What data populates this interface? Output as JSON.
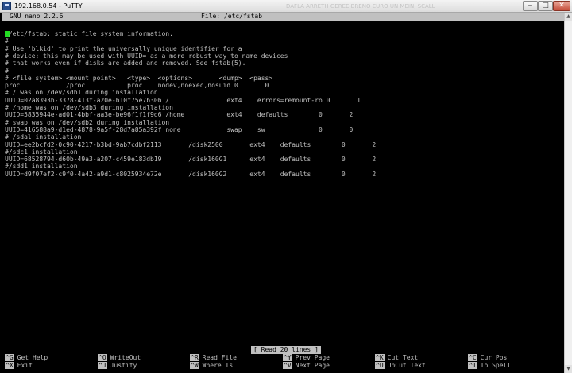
{
  "window": {
    "title": "192.168.0.54 - PuTTY",
    "ghost_text": "DAFLA ARRETH GEREE BRENO EURO UN MEIN, SCALL",
    "minimize_glyph": "‒",
    "maximize_glyph": "□",
    "close_glyph": "✕"
  },
  "scrollbar": {
    "up_glyph": "▲",
    "down_glyph": "▼"
  },
  "nano": {
    "version": "GNU nano 2.2.6",
    "file_label": "File: /etc/fstab",
    "lines": [
      " /etc/fstab: static file system information.",
      "#",
      "# Use 'blkid' to print the universally unique identifier for a",
      "# device; this may be used with UUID= as a more robust way to name devices",
      "# that works even if disks are added and removed. See fstab(5).",
      "#",
      "# <file system> <mount point>   <type>  <options>       <dump>  <pass>",
      "proc            /proc           proc    nodev,noexec,nosuid 0       0",
      "# / was on /dev/sdb1 during installation",
      "UUID=02a8393b-3378-413f-a20e-b10f75e7b30b /               ext4    errors=remount-ro 0       1",
      "# /home was on /dev/sdb3 during installation",
      "UUID=5835944e-ad01-4bbf-aa3e-be96f1f1f9d6 /home           ext4    defaults        0       2",
      "# swap was on /dev/sdb2 during installation",
      "UUID=416588a9-d1ed-4878-9a5f-28d7a85a392f none            swap    sw              0       0",
      "# /sdal installation",
      "UUID=ee2bcfd2-0c90-4217-b3bd-9ab7cdbf2113       /disk250G       ext4    defaults        0       2",
      "#/sdc1 installation",
      "UUID=68528794-d60b-49a3-a207-c459e183db19       /disk160G1      ext4    defaults        0       2",
      "#/sdd1 installation",
      "UUID=d9f07ef2-c9f0-4a42-a9d1-c8025934e72e       /disk160G2      ext4    defaults        0       2"
    ],
    "status_message": "[ Read 20 lines ]",
    "shortcuts": [
      [
        {
          "key": "^G",
          "label": "Get Help"
        },
        {
          "key": "^O",
          "label": "WriteOut"
        },
        {
          "key": "^R",
          "label": "Read File"
        },
        {
          "key": "^Y",
          "label": "Prev Page"
        },
        {
          "key": "^K",
          "label": "Cut Text"
        },
        {
          "key": "^C",
          "label": "Cur Pos"
        }
      ],
      [
        {
          "key": "^X",
          "label": "Exit"
        },
        {
          "key": "^J",
          "label": "Justify"
        },
        {
          "key": "^W",
          "label": "Where Is"
        },
        {
          "key": "^V",
          "label": "Next Page"
        },
        {
          "key": "^U",
          "label": "UnCut Text"
        },
        {
          "key": "^T",
          "label": "To Spell"
        }
      ]
    ]
  }
}
